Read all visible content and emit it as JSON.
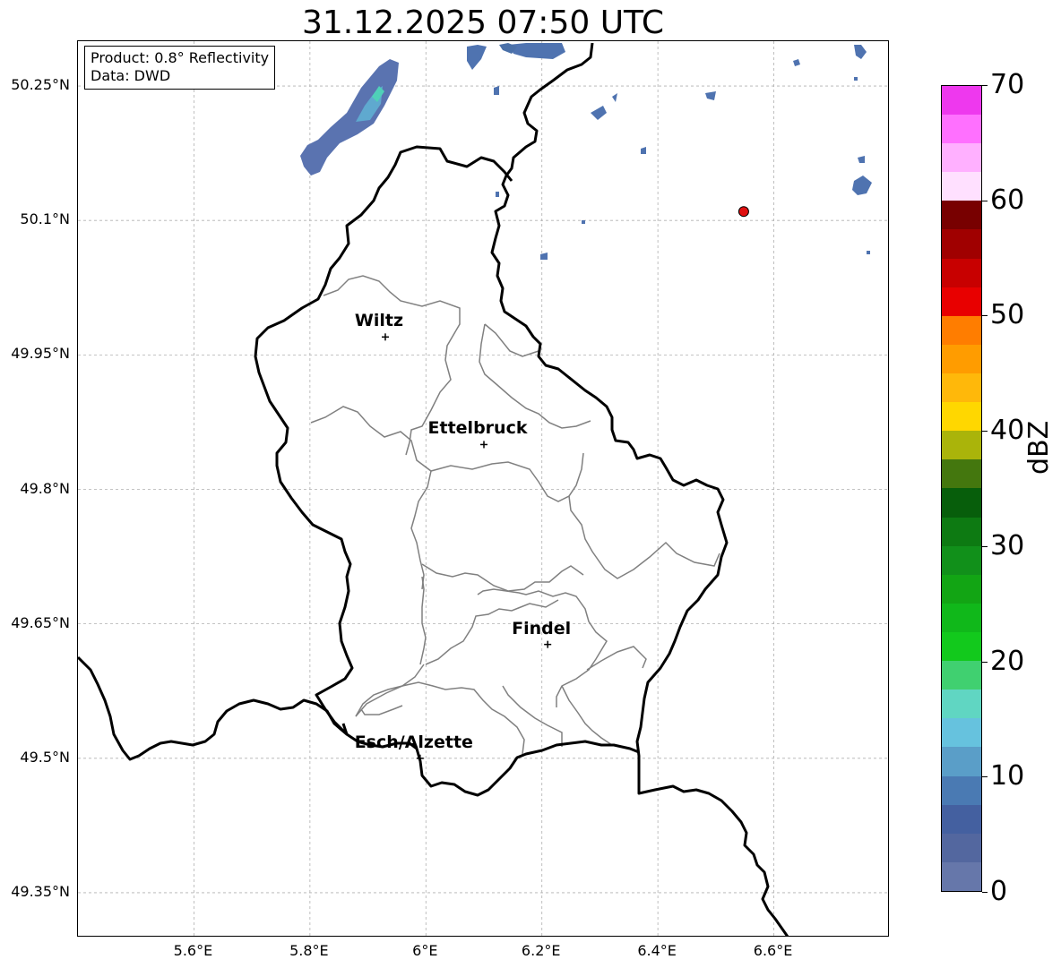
{
  "title": "31.12.2025 07:50 UTC",
  "info": {
    "product": "Product: 0.8° Reflectivity",
    "source": "Data: DWD"
  },
  "map": {
    "lat_range": [
      49.3,
      50.3
    ],
    "lon_range": [
      5.4,
      6.8
    ],
    "lat_ticks": [
      50.25,
      50.1,
      49.95,
      49.8,
      49.65,
      49.5,
      49.35
    ],
    "lat_tick_labels": [
      "50.25°N",
      "50.1°N",
      "49.95°N",
      "49.8°N",
      "49.65°N",
      "49.5°N",
      "49.35°N"
    ],
    "lon_ticks": [
      5.6,
      5.8,
      6.0,
      6.2,
      6.4,
      6.6
    ],
    "lon_tick_labels": [
      "5.6°E",
      "5.8°E",
      "6°E",
      "6.2°E",
      "6.4°E",
      "6.6°E"
    ],
    "grid": true,
    "cities": [
      {
        "name": "Wiltz",
        "lat": 49.97,
        "lon": 5.93
      },
      {
        "name": "Ettelbruck",
        "lat": 49.85,
        "lon": 6.1
      },
      {
        "name": "Findel",
        "lat": 49.627,
        "lon": 6.21
      },
      {
        "name": "Esch/Alzette",
        "lat": 49.5,
        "lon": 5.99
      }
    ],
    "radar_site": {
      "lat": 50.11,
      "lon": 6.548,
      "color": "#e01010"
    }
  },
  "colorbar": {
    "label": "dBZ",
    "ticks": [
      "0",
      "10",
      "20",
      "30",
      "40",
      "50",
      "60",
      "70"
    ],
    "colors": [
      "#6677aa",
      "#53679f",
      "#4460a0",
      "#4a7ab3",
      "#5a9ec8",
      "#66c2de",
      "#60d6c2",
      "#40d070",
      "#12c91c",
      "#10b81a",
      "#12a514",
      "#11901a",
      "#0d7a12",
      "#075e0b",
      "#44770e",
      "#aab40a",
      "#ffd700",
      "#ffb80a",
      "#ff9c00",
      "#ff7d00",
      "#e80000",
      "#c80000",
      "#a00000",
      "#780000",
      "#ffe0ff",
      "#ffb0ff",
      "#ff70ff",
      "#ee38ee"
    ]
  }
}
